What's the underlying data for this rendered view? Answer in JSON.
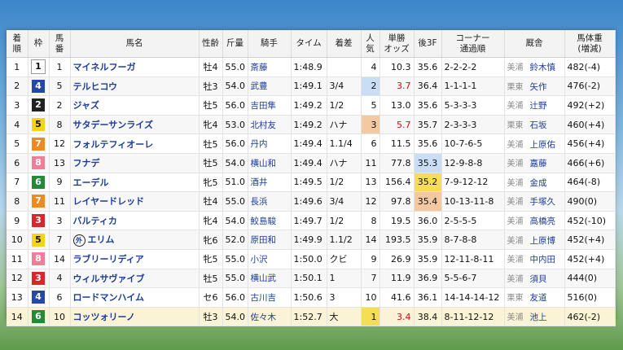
{
  "headers": {
    "rank": "着\n順",
    "waku": "枠",
    "umaban": "馬\n番",
    "horse": "馬名",
    "sexage": "性齢",
    "weight": "斤量",
    "jockey": "騎手",
    "time": "タイム",
    "margin": "着差",
    "pop": "人\n気",
    "odds": "単勝\nオッズ",
    "last3f": "後3F",
    "corner": "コーナー\n通過順",
    "stable": "厩舎",
    "bodyweight": "馬体重\n(増減)"
  },
  "colors": {
    "waku": {
      "1": {
        "bg": "#ffffff",
        "fg": "#111111"
      },
      "2": {
        "bg": "#222222",
        "fg": "#ffffff"
      },
      "3": {
        "bg": "#d9262a",
        "fg": "#ffffff"
      },
      "4": {
        "bg": "#2448a8",
        "fg": "#ffffff"
      },
      "5": {
        "bg": "#f5d21c",
        "fg": "#111111"
      },
      "6": {
        "bg": "#238a3a",
        "fg": "#ffffff"
      },
      "7": {
        "bg": "#ee8a1e",
        "fg": "#ffffff"
      },
      "8": {
        "bg": "#f07e9a",
        "fg": "#ffffff"
      }
    },
    "pop_highlight": {
      "1": "#f5dd55",
      "2": "#c9ddf5",
      "3": "#f3c9a2"
    },
    "last3f_highlight": {
      "1": "#f5dd55",
      "2": "#c9ddf5",
      "3": "#f3c9a2"
    }
  },
  "rows": [
    {
      "rank": "1",
      "waku": "1",
      "umaban": "1",
      "horse": "マイネルフーガ",
      "mark": "",
      "sexage": "牡4",
      "weight": "55.0",
      "jockey": "斎藤",
      "time": "1:48.9",
      "margin": "",
      "pop": "4",
      "odds": "10.3",
      "last3f": "35.6",
      "corner": "2-2-2-2",
      "loc": "美浦",
      "trainer": "鈴木慎",
      "bodyweight": "482(-4)",
      "pop_rank": "",
      "f3_rank": ""
    },
    {
      "rank": "2",
      "waku": "4",
      "umaban": "5",
      "horse": "テルヒコウ",
      "mark": "",
      "sexage": "牡3",
      "weight": "54.0",
      "jockey": "武豊",
      "time": "1:49.1",
      "margin": "3/4",
      "pop": "2",
      "odds": "3.7",
      "last3f": "36.4",
      "corner": "1-1-1-1",
      "loc": "栗東",
      "trainer": "矢作",
      "bodyweight": "476(-2)",
      "pop_rank": "2",
      "f3_rank": ""
    },
    {
      "rank": "3",
      "waku": "2",
      "umaban": "2",
      "horse": "ジャズ",
      "mark": "",
      "sexage": "牡5",
      "weight": "56.0",
      "jockey": "吉田隼",
      "time": "1:49.2",
      "margin": "1/2",
      "pop": "5",
      "odds": "13.0",
      "last3f": "35.6",
      "corner": "5-3-3-3",
      "loc": "美浦",
      "trainer": "辻野",
      "bodyweight": "492(+2)",
      "pop_rank": "",
      "f3_rank": ""
    },
    {
      "rank": "4",
      "waku": "5",
      "umaban": "8",
      "horse": "サタデーサンライズ",
      "mark": "",
      "sexage": "牝4",
      "weight": "53.0",
      "jockey": "北村友",
      "time": "1:49.2",
      "margin": "ハナ",
      "pop": "3",
      "odds": "5.7",
      "last3f": "35.7",
      "corner": "2-3-3-3",
      "loc": "栗東",
      "trainer": "石坂",
      "bodyweight": "460(+4)",
      "pop_rank": "3",
      "f3_rank": ""
    },
    {
      "rank": "5",
      "waku": "7",
      "umaban": "12",
      "horse": "フォルテフィオーレ",
      "mark": "",
      "sexage": "牡5",
      "weight": "56.0",
      "jockey": "丹内",
      "time": "1:49.4",
      "margin": "1.1/4",
      "pop": "6",
      "odds": "11.5",
      "last3f": "35.6",
      "corner": "10-7-6-5",
      "loc": "美浦",
      "trainer": "上原佑",
      "bodyweight": "456(+4)",
      "pop_rank": "",
      "f3_rank": ""
    },
    {
      "rank": "6",
      "waku": "8",
      "umaban": "13",
      "horse": "フナデ",
      "mark": "",
      "sexage": "牡5",
      "weight": "54.0",
      "jockey": "横山和",
      "time": "1:49.4",
      "margin": "ハナ",
      "pop": "11",
      "odds": "77.8",
      "last3f": "35.3",
      "corner": "12-9-8-8",
      "loc": "美浦",
      "trainer": "嘉藤",
      "bodyweight": "466(+6)",
      "pop_rank": "",
      "f3_rank": "2"
    },
    {
      "rank": "7",
      "waku": "6",
      "umaban": "9",
      "horse": "エーデル",
      "mark": "",
      "sexage": "牝5",
      "weight": "51.0",
      "jockey": "酒井",
      "time": "1:49.5",
      "margin": "1/2",
      "pop": "13",
      "odds": "156.4",
      "last3f": "35.2",
      "corner": "7-9-12-12",
      "loc": "美浦",
      "trainer": "金成",
      "bodyweight": "464(-8)",
      "pop_rank": "",
      "f3_rank": "1"
    },
    {
      "rank": "8",
      "waku": "7",
      "umaban": "11",
      "horse": "レイヤードレッド",
      "mark": "",
      "sexage": "牡4",
      "weight": "55.0",
      "jockey": "長浜",
      "time": "1:49.6",
      "margin": "3/4",
      "pop": "12",
      "odds": "97.8",
      "last3f": "35.4",
      "corner": "10-13-11-8",
      "loc": "美浦",
      "trainer": "手塚久",
      "bodyweight": "490(0)",
      "pop_rank": "",
      "f3_rank": "3"
    },
    {
      "rank": "9",
      "waku": "3",
      "umaban": "3",
      "horse": "バルティカ",
      "mark": "",
      "sexage": "牝4",
      "weight": "54.0",
      "jockey": "鮫島駿",
      "time": "1:49.7",
      "margin": "1/2",
      "pop": "8",
      "odds": "19.5",
      "last3f": "36.0",
      "corner": "2-5-5-5",
      "loc": "美浦",
      "trainer": "高橋亮",
      "bodyweight": "452(-10)",
      "pop_rank": "",
      "f3_rank": ""
    },
    {
      "rank": "10",
      "waku": "5",
      "umaban": "7",
      "horse": "エリム",
      "mark": "外",
      "sexage": "牝6",
      "weight": "52.0",
      "jockey": "原田和",
      "time": "1:49.9",
      "margin": "1.1/2",
      "pop": "14",
      "odds": "193.5",
      "last3f": "35.9",
      "corner": "8-7-8-8",
      "loc": "美浦",
      "trainer": "上原博",
      "bodyweight": "452(+4)",
      "pop_rank": "",
      "f3_rank": ""
    },
    {
      "rank": "11",
      "waku": "8",
      "umaban": "14",
      "horse": "ラブリーリディア",
      "mark": "",
      "sexage": "牝5",
      "weight": "55.0",
      "jockey": "小沢",
      "time": "1:50.0",
      "margin": "クビ",
      "pop": "9",
      "odds": "26.9",
      "last3f": "35.9",
      "corner": "12-11-8-11",
      "loc": "美浦",
      "trainer": "中内田",
      "bodyweight": "452(+4)",
      "pop_rank": "",
      "f3_rank": ""
    },
    {
      "rank": "12",
      "waku": "3",
      "umaban": "4",
      "horse": "ウィルサヴァイブ",
      "mark": "",
      "sexage": "牡5",
      "weight": "55.0",
      "jockey": "横山武",
      "time": "1:50.1",
      "margin": "1",
      "pop": "7",
      "odds": "11.9",
      "last3f": "36.9",
      "corner": "5-5-6-7",
      "loc": "美浦",
      "trainer": "須貝",
      "bodyweight": "444(0)",
      "pop_rank": "",
      "f3_rank": ""
    },
    {
      "rank": "13",
      "waku": "4",
      "umaban": "6",
      "horse": "ロードマンハイム",
      "mark": "",
      "sexage": "セ6",
      "weight": "56.0",
      "jockey": "古川吉",
      "time": "1:50.6",
      "margin": "3",
      "pop": "10",
      "odds": "41.6",
      "last3f": "36.1",
      "corner": "14-14-14-12",
      "loc": "栗東",
      "trainer": "友道",
      "bodyweight": "516(0)",
      "pop_rank": "",
      "f3_rank": ""
    },
    {
      "rank": "14",
      "waku": "6",
      "umaban": "10",
      "horse": "コッツォリーノ",
      "mark": "",
      "sexage": "牡3",
      "weight": "54.0",
      "jockey": "佐々木",
      "time": "1:52.7",
      "margin": "大",
      "pop": "1",
      "odds": "3.4",
      "last3f": "38.4",
      "corner": "8-11-12-12",
      "loc": "美浦",
      "trainer": "池上",
      "bodyweight": "462(-2)",
      "pop_rank": "1",
      "f3_rank": ""
    }
  ]
}
